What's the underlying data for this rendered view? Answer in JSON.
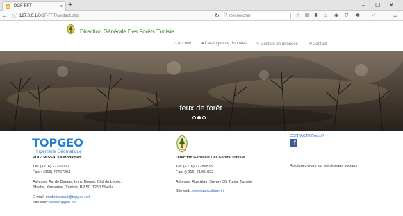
{
  "browser": {
    "tab_title": "DGF-FFT",
    "tab_close": "×",
    "new_tab": "+",
    "window_controls": {
      "minimize": "–",
      "maximize": "☐",
      "close": "✕"
    },
    "url_host": "127.0.0.1",
    "url_path": "/DGF-FFT/contact.php",
    "search_placeholder": "Rechercher",
    "icons": [
      "star-icon",
      "reader-icon",
      "download-icon",
      "home-icon",
      "pocket-icon",
      "shield-icon",
      "addon-icon",
      "wand-icon",
      "menu-icon"
    ]
  },
  "header": {
    "title": "Direction Générale Des Forêts Tunisie",
    "menu": [
      {
        "icon": "home-icon",
        "label": "Accueil"
      },
      {
        "icon": "globe-icon",
        "label": "Catalogue de données"
      },
      {
        "icon": "edit-icon",
        "label": "Gestion de données"
      },
      {
        "icon": "mail-icon",
        "label": "Contact"
      }
    ]
  },
  "hero": {
    "caption": "feux de forêt",
    "slides": 3,
    "active_slide": 2
  },
  "footer": {
    "topgeo": {
      "logo_text": "TOPGEO",
      "logo_sub": "Ingénierie Géomatique",
      "pdg": "PDG: MISSAOUI Mohamed",
      "tel": "Tél: (+216) 22702722",
      "fax": "Fax: (+216) 77467203",
      "address_1": "Adresse: Av. de Damas, Imm. Noumi, Cité du Lycée,",
      "address_2": "Sbeitla, Kasserine, Tunisie, BP 50. 1250 Sbeitla",
      "email_label": "E-mail: ",
      "email": "medmissaoui@topgeo.net",
      "web_label": "Site web: ",
      "web": "www.topgeo.net"
    },
    "dgf": {
      "name": "Direction Générale Des Forêts Tunisie",
      "tel": "Tél: (+216) 71786833",
      "fax": "Fax: (+216) 71801922",
      "address": "Adresse: Rue Alain Savary 30, Tunis, Tunisie",
      "web_label": "Site web: ",
      "web": "www.agriculture.tn"
    },
    "social": {
      "contact_label": "CONTACTEZ-nous?",
      "join_text": "Rejoignez-nous sur les réseaux sociaux !"
    }
  },
  "colors": {
    "title_green": "#3a7a1f",
    "link_blue": "#2a6ebb",
    "facebook": "#3b5998",
    "topgeo_blue": "#1f7fd0",
    "topgeo_green": "#2fae3a"
  }
}
